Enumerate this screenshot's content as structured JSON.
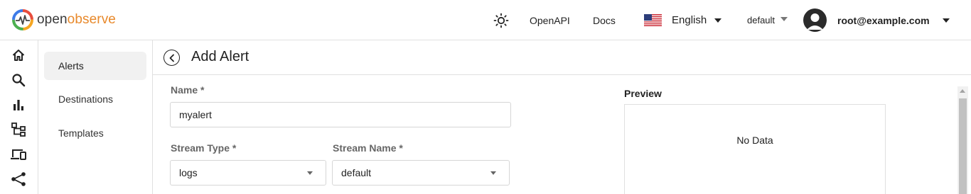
{
  "header": {
    "logo_open": "open",
    "logo_observe": "observe",
    "theme_icon": "sun-icon",
    "openapi_label": "OpenAPI",
    "docs_label": "Docs",
    "language": {
      "label": "English",
      "flag": "us-flag-icon"
    },
    "org": {
      "label": "default"
    },
    "user": {
      "label": "root@example.com",
      "avatar": "avatar-icon"
    }
  },
  "rail": {
    "items": [
      {
        "icon": "home-icon"
      },
      {
        "icon": "search-icon"
      },
      {
        "icon": "bar-chart-icon"
      },
      {
        "icon": "hierarchy-icon"
      },
      {
        "icon": "devices-icon"
      },
      {
        "icon": "share-icon"
      }
    ]
  },
  "subnav": {
    "items": [
      {
        "label": "Alerts",
        "active": true
      },
      {
        "label": "Destinations",
        "active": false
      },
      {
        "label": "Templates",
        "active": false
      }
    ]
  },
  "page": {
    "title": "Add Alert",
    "back_icon": "back-arrow-icon"
  },
  "form": {
    "name": {
      "label": "Name *",
      "value": "myalert"
    },
    "stream_type": {
      "label": "Stream Type *",
      "value": "logs"
    },
    "stream_name": {
      "label": "Stream Name *",
      "value": "default"
    }
  },
  "preview": {
    "label": "Preview",
    "empty_text": "No Data"
  },
  "colors": {
    "brand_orange": "#e8892b",
    "border": "#e0e0e0",
    "active_bg": "#f1f1f1"
  }
}
